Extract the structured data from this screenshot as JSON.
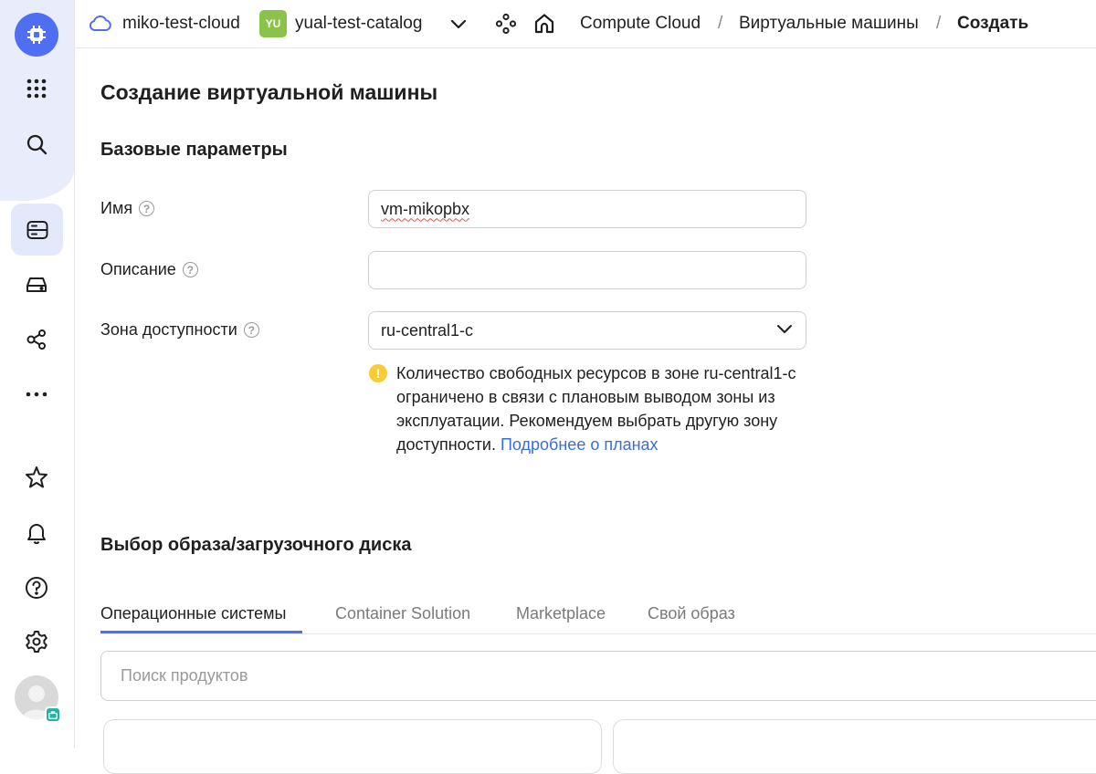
{
  "topbar": {
    "cloud_name": "miko-test-cloud",
    "catalog_badge": "YU",
    "catalog_name": "yual-test-catalog",
    "breadcrumbs": [
      "Compute Cloud",
      "Виртуальные машины",
      "Создать"
    ],
    "separator": "/"
  },
  "page": {
    "title": "Создание виртуальной машины"
  },
  "basic": {
    "heading": "Базовые параметры",
    "name_label": "Имя",
    "name_value": "vm-mikopbx",
    "description_label": "Описание",
    "description_value": "",
    "zone_label": "Зона доступности",
    "zone_value": "ru-central1-c",
    "help_glyph": "?",
    "warning_glyph": "!",
    "warning_text": "Количество свободных ресурсов в зоне ru-central1-c ограничено в связи с плановым выводом зоны из эксплуатации. Рекомендуем выбрать другую зону доступности.",
    "warning_link": "Подробнее о планах"
  },
  "image": {
    "heading": "Выбор образа/загрузочного диска",
    "tabs": [
      "Операционные системы",
      "Container Solution",
      "Marketplace",
      "Свой образ"
    ],
    "active_tab": 0,
    "search_placeholder": "Поиск продуктов"
  },
  "colors": {
    "accent": "#4f6ef1",
    "rail_bg": "#e9ecfb",
    "catalog_badge": "#8bc34a",
    "warning": "#f7cc35",
    "link": "#3a6cdd"
  },
  "icons": {
    "rail": [
      "compute-logo-icon",
      "apps-grid-icon",
      "search-icon",
      "vm-list-icon",
      "disk-icon",
      "network-icon",
      "more-icon",
      "star-icon",
      "bell-icon",
      "help-icon",
      "gear-icon",
      "avatar"
    ]
  }
}
